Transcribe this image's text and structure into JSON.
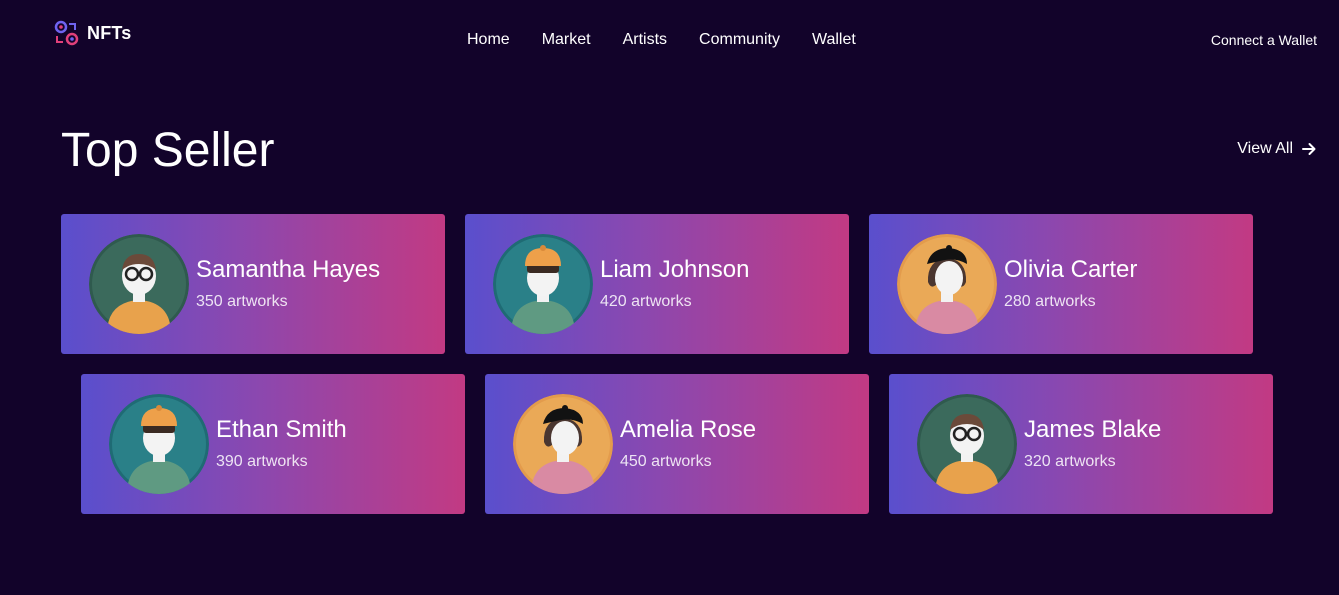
{
  "header": {
    "logo_text": "NFTs",
    "nav": [
      "Home",
      "Market",
      "Artists",
      "Community",
      "Wallet"
    ],
    "connect_label": "Connect a Wallet"
  },
  "section": {
    "title": "Top Seller",
    "view_all_label": "View All"
  },
  "sellers": [
    {
      "name": "Samantha Hayes",
      "count": "350 artworks",
      "avatar": "avatar-glasses-man"
    },
    {
      "name": "Liam Johnson",
      "count": "420 artworks",
      "avatar": "avatar-orange-cap"
    },
    {
      "name": "Olivia Carter",
      "count": "280 artworks",
      "avatar": "avatar-black-beret-woman"
    },
    {
      "name": "Ethan Smith",
      "count": "390 artworks",
      "avatar": "avatar-orange-cap"
    },
    {
      "name": "Amelia Rose",
      "count": "450 artworks",
      "avatar": "avatar-black-beret-woman"
    },
    {
      "name": "James Blake",
      "count": "320 artworks",
      "avatar": "avatar-glasses-man"
    }
  ],
  "colors": {
    "background": "#12032a",
    "card_gradient_start": "#5a4fcd",
    "card_gradient_end": "#c23a83",
    "text": "#ffffff"
  }
}
